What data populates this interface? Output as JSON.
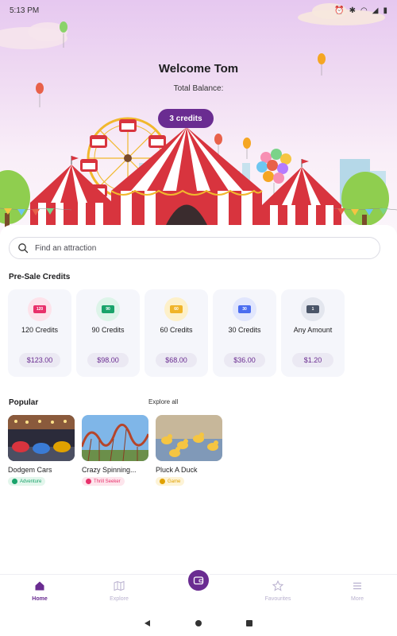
{
  "status_bar": {
    "time": "5:13 PM",
    "icons": [
      "alarm-icon",
      "bluetooth-icon",
      "wifi-icon",
      "signal-icon",
      "battery-icon"
    ]
  },
  "header": {
    "welcome": "Welcome Tom",
    "balance_label": "Total Balance:",
    "balance_value": "3 credits"
  },
  "search": {
    "placeholder": "Find an attraction",
    "value": ""
  },
  "presale": {
    "title": "Pre-Sale Credits",
    "cards": [
      {
        "badge": "120",
        "label": "120 Credits",
        "price": "$123.00",
        "color": "#e8316b",
        "bg": "#fde2ea"
      },
      {
        "badge": "90",
        "label": "90 Credits",
        "price": "$98.00",
        "color": "#1aa36b",
        "bg": "#ddf4e9"
      },
      {
        "badge": "60",
        "label": "60 Credits",
        "price": "$68.00",
        "color": "#f0b429",
        "bg": "#fdf0c9"
      },
      {
        "badge": "30",
        "label": "30 Credits",
        "price": "$36.00",
        "color": "#4a6cf0",
        "bg": "#e1e6fd"
      },
      {
        "badge": "1",
        "label": "Any Amount",
        "price": "$1.20",
        "color": "#4a5568",
        "bg": "#e3e6ee"
      }
    ]
  },
  "popular": {
    "title": "Popular",
    "explore_all": "Explore all",
    "items": [
      {
        "name": "Dodgem Cars",
        "tag": "Adventure",
        "tag_color": "#1aa36b",
        "tag_bg": "#e3f6ec"
      },
      {
        "name": "Crazy Spinning...",
        "tag": "Thrill Seeker",
        "tag_color": "#e8316b",
        "tag_bg": "#fde5ec"
      },
      {
        "name": "Pluck A Duck",
        "tag": "Game",
        "tag_color": "#e0a100",
        "tag_bg": "#fdf3d6"
      }
    ]
  },
  "bottom_nav": {
    "items": [
      {
        "label": "Home",
        "icon": "home-icon",
        "active": true
      },
      {
        "label": "Explore",
        "icon": "map-icon",
        "active": false
      },
      {
        "label": "Favourites",
        "icon": "star-icon",
        "active": false
      },
      {
        "label": "More",
        "icon": "menu-icon",
        "active": false
      }
    ],
    "center_icon": "wallet-icon"
  },
  "colors": {
    "accent": "#6a2c91",
    "hero_top": "#e6c8f0",
    "tent_red": "#d8343e"
  }
}
